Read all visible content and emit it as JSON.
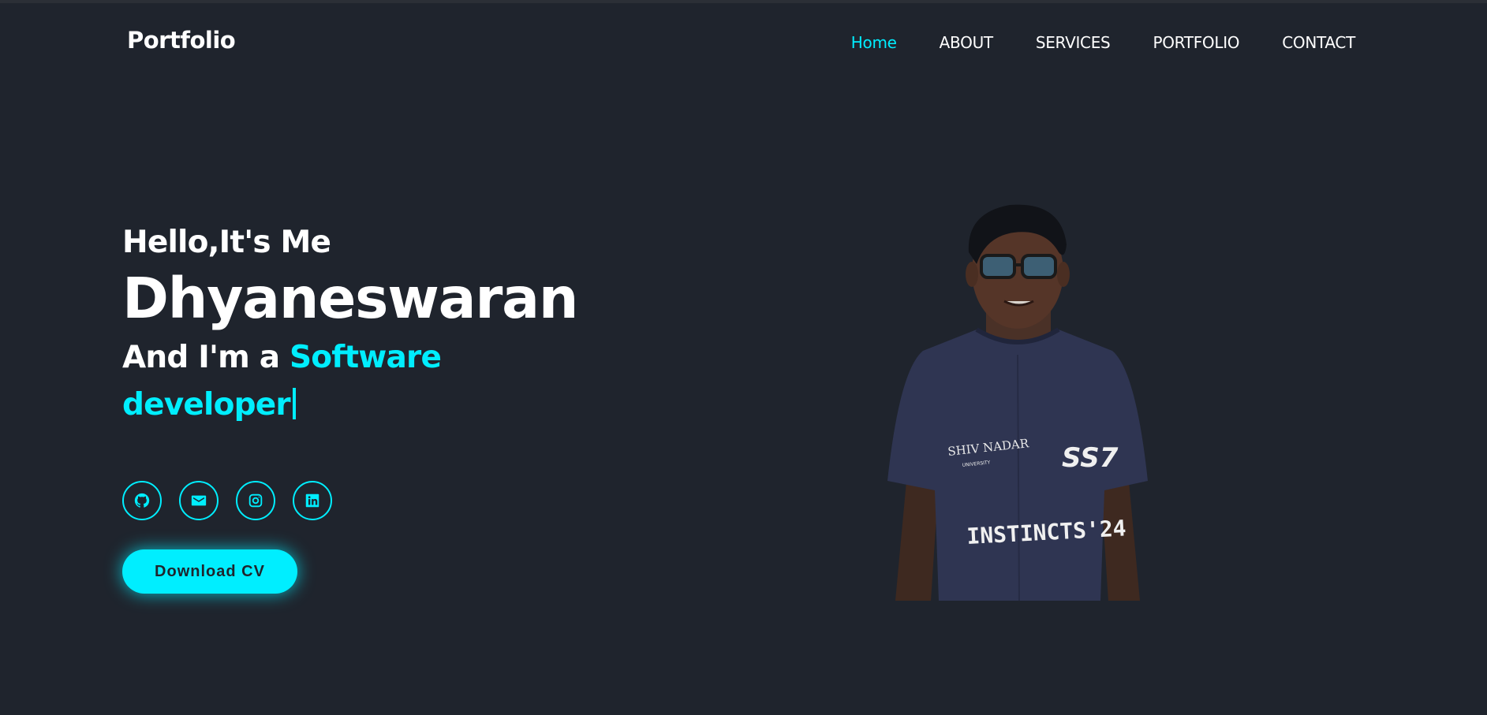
{
  "header": {
    "logo": "Portfolio",
    "nav": [
      {
        "label": "Home",
        "active": true
      },
      {
        "label": "ABOUT"
      },
      {
        "label": "SERVICES"
      },
      {
        "label": "PORTFOLIO"
      },
      {
        "label": "CONTACT"
      }
    ]
  },
  "hero": {
    "greeting": "Hello,It's Me",
    "name": "Dhyaneswaran",
    "role_prefix": "And I'm a",
    "role_highlight": "Software developer",
    "socials": [
      {
        "icon": "github-icon"
      },
      {
        "icon": "email-icon"
      },
      {
        "icon": "instagram-icon"
      },
      {
        "icon": "linkedin-icon"
      }
    ],
    "cv_button": "Download CV",
    "photo_shirt_text_1": "SHIV NADAR",
    "photo_shirt_text_2": "UNIVERSITY",
    "photo_shirt_text_3": "SS7",
    "photo_shirt_text_4": "INSTINCTS'24"
  },
  "colors": {
    "background": "#1f242d",
    "accent": "#00eeff",
    "text": "#ffffff"
  }
}
